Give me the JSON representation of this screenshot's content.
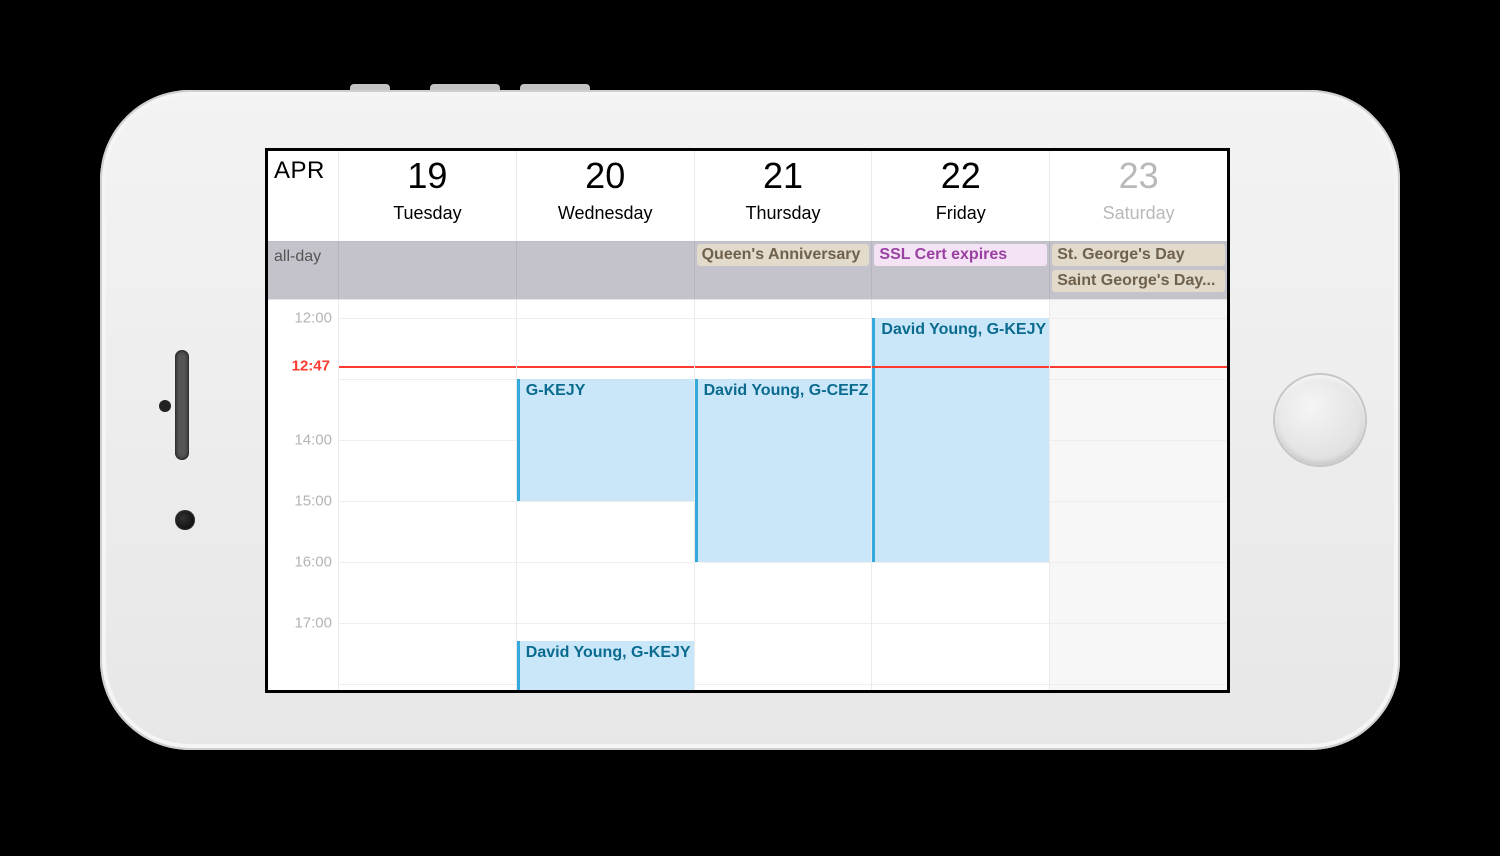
{
  "month_label": "APR",
  "allday_label": "all-day",
  "current_time": {
    "label": "12:47",
    "hour": 12.783
  },
  "grid": {
    "start_hour": 11.7,
    "end_hour": 18.1,
    "labeled_hours": [
      12,
      14,
      15,
      16,
      17
    ],
    "line_hours": [
      12,
      13,
      14,
      15,
      16,
      17,
      18
    ]
  },
  "days": [
    {
      "num": "19",
      "dow": "Tuesday",
      "weekend": false,
      "allday": [],
      "events": []
    },
    {
      "num": "20",
      "dow": "Wednesday",
      "weekend": false,
      "allday": [],
      "events": [
        {
          "title": "G-KEJY",
          "start": 13.0,
          "end": 15.0
        },
        {
          "title": "David Young, G-KEJY",
          "start": 17.3,
          "end": 18.3
        }
      ]
    },
    {
      "num": "21",
      "dow": "Thursday",
      "weekend": false,
      "allday": [
        {
          "title": "Queen's Anniversary",
          "category": "brown"
        }
      ],
      "events": [
        {
          "title": "David Young, G-CEFZ",
          "start": 13.0,
          "end": 16.0
        }
      ]
    },
    {
      "num": "22",
      "dow": "Friday",
      "weekend": false,
      "allday": [
        {
          "title": "SSL Cert expires",
          "category": "purple"
        }
      ],
      "events": [
        {
          "title": "David Young, G-KEJY",
          "start": 12.0,
          "end": 16.0
        }
      ]
    },
    {
      "num": "23",
      "dow": "Saturday",
      "weekend": true,
      "allday": [
        {
          "title": "St. George's Day",
          "category": "brown"
        },
        {
          "title": "Saint George's Day...",
          "category": "brown"
        }
      ],
      "events": []
    }
  ]
}
